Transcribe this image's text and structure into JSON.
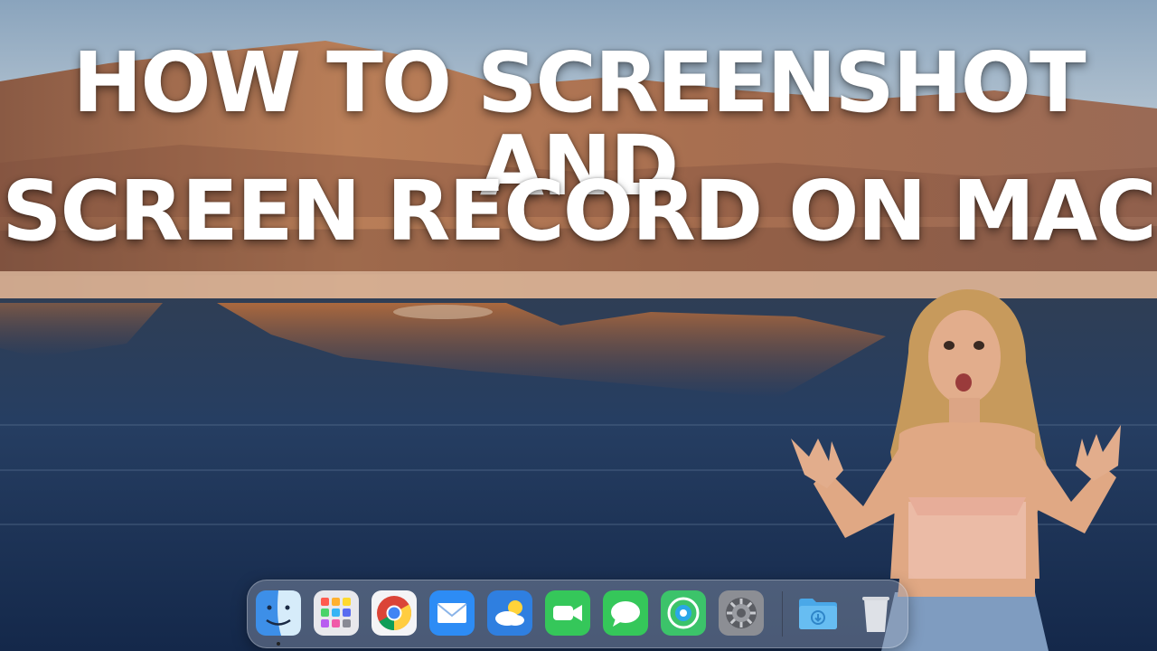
{
  "title": {
    "line1": "HOW TO SCREENSHOT AND",
    "line2": "SCREEN RECORD ON MAC"
  },
  "dock": {
    "apps": [
      {
        "name": "Finder",
        "icon": "finder-icon",
        "running": true
      },
      {
        "name": "Launchpad",
        "icon": "launchpad-icon",
        "running": false
      },
      {
        "name": "Google Chrome",
        "icon": "chrome-icon",
        "running": false
      },
      {
        "name": "Mail",
        "icon": "mail-icon",
        "running": false
      },
      {
        "name": "Weather",
        "icon": "weather-icon",
        "running": false
      },
      {
        "name": "FaceTime",
        "icon": "facetime-icon",
        "running": false
      },
      {
        "name": "Messages",
        "icon": "messages-icon",
        "running": false
      },
      {
        "name": "Find My",
        "icon": "find-my-icon",
        "running": false
      },
      {
        "name": "System Settings",
        "icon": "settings-icon",
        "running": false
      }
    ],
    "folders": [
      {
        "name": "Downloads",
        "icon": "downloads-folder-icon"
      },
      {
        "name": "Trash",
        "icon": "trash-icon"
      }
    ]
  },
  "colors": {
    "sky": "#9fb4c8",
    "rock": "#b9805a",
    "water": "#1c3454",
    "title_text": "#ffffff"
  }
}
